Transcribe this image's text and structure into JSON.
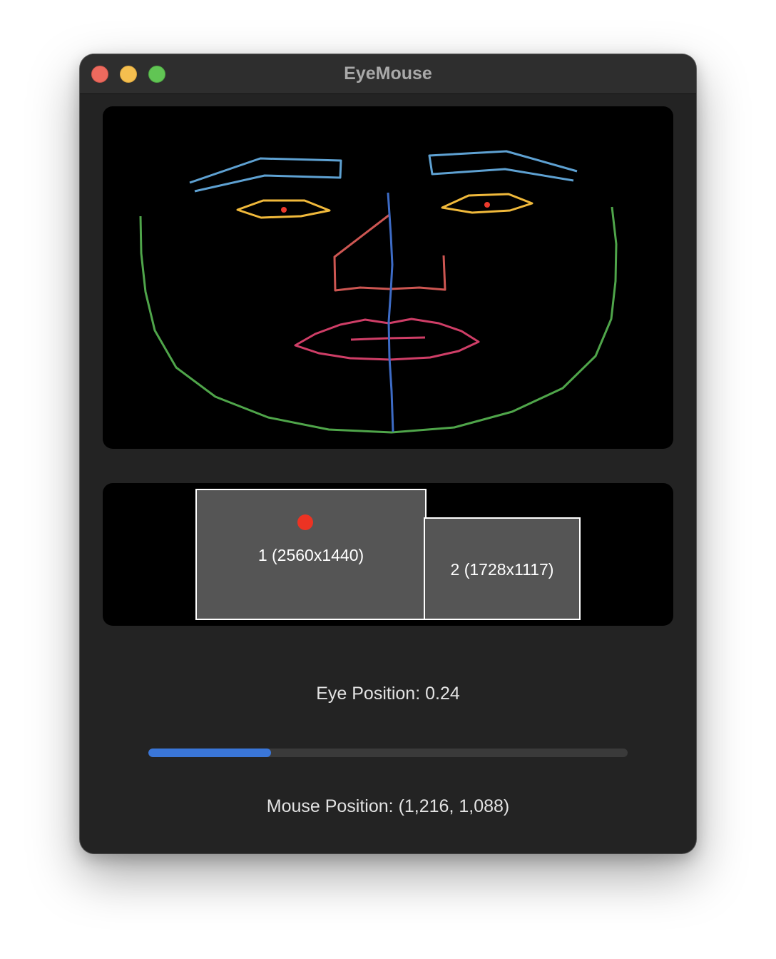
{
  "window": {
    "title": "EyeMouse"
  },
  "face_mesh": {
    "colors": {
      "jaw": "#4fa54a",
      "eyebrows": "#5ea1d2",
      "eyes": "#f0b93b",
      "pupils": "#ec3a2c",
      "nose": "#cd5652",
      "lips": "#cf3e67",
      "midline": "#3d6bc5"
    }
  },
  "displays": {
    "items": [
      {
        "label": "1 (2560x1440)"
      },
      {
        "label": "2 (1728x1117)"
      }
    ],
    "gaze_dot_color": "#ec3323"
  },
  "eye_position": {
    "text": "Eye Position: 0.24",
    "value": 0.24
  },
  "progress": {
    "value": 0.256,
    "fill_color": "#3a76d8",
    "track_color": "#3a3a3a"
  },
  "mouse_position": {
    "text": "Mouse Position: (1,216, 1,088)"
  }
}
